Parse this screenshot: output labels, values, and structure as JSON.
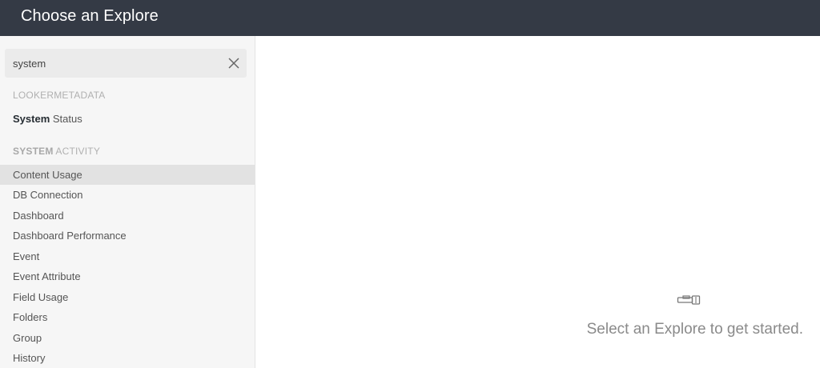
{
  "header": {
    "title": "Choose an Explore"
  },
  "search": {
    "value": "system",
    "placeholder": ""
  },
  "groups": [
    {
      "match": "LOOKERMETADATA",
      "rest": "",
      "items": [
        {
          "match": "System",
          "rest": " Status"
        }
      ]
    },
    {
      "match": "SYSTEM",
      "rest": " ACTIVITY",
      "items": [
        {
          "match": "",
          "rest": "Content Usage",
          "selected": true
        },
        {
          "match": "",
          "rest": "DB Connection"
        },
        {
          "match": "",
          "rest": "Dashboard"
        },
        {
          "match": "",
          "rest": "Dashboard Performance"
        },
        {
          "match": "",
          "rest": "Event"
        },
        {
          "match": "",
          "rest": "Event Attribute"
        },
        {
          "match": "",
          "rest": "Field Usage"
        },
        {
          "match": "",
          "rest": "Folders"
        },
        {
          "match": "",
          "rest": "Group"
        },
        {
          "match": "",
          "rest": "History"
        }
      ]
    }
  ],
  "empty_state": {
    "message": "Select an Explore to get started.",
    "icon": "explore-binoculars-icon"
  },
  "colors": {
    "header_bg": "#343a45",
    "sidebar_bg": "#f6f6f6",
    "selected_bg": "#e2e2e2"
  }
}
